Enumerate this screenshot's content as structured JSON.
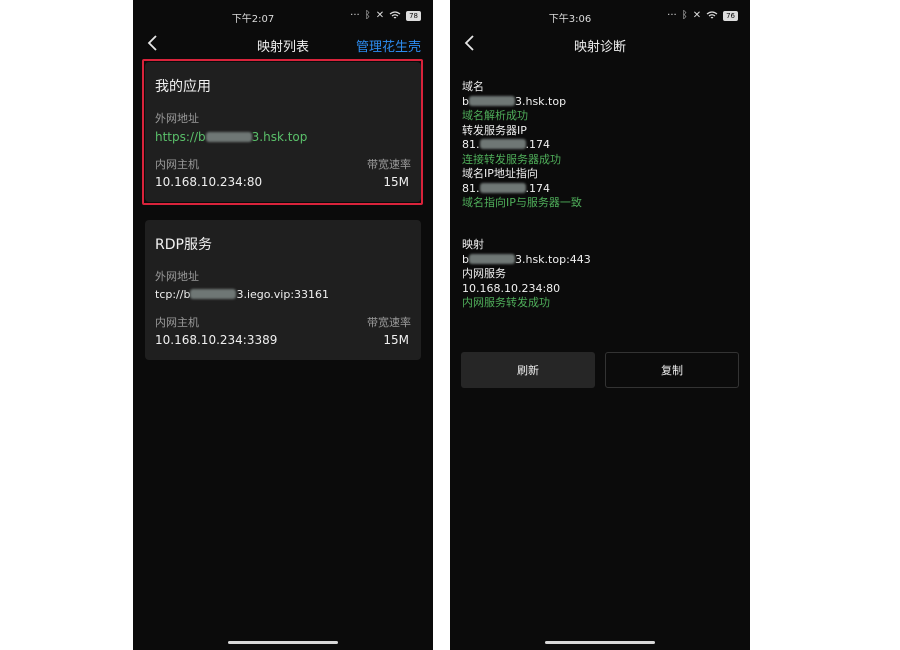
{
  "left": {
    "time": "下午2:07",
    "battery": "78",
    "title": "映射列表",
    "action": "管理花生壳",
    "cards": [
      {
        "title": "我的应用",
        "ext_label": "外网地址",
        "ext_prefix": "https://b",
        "ext_suffix": "3.hsk.top",
        "host_label": "内网主机",
        "host_value": "10.168.10.234:80",
        "bw_label": "带宽速率",
        "bw_value": "15M"
      },
      {
        "title": "RDP服务",
        "ext_label": "外网地址",
        "ext_prefix": "tcp://b",
        "ext_suffix": "3.iego.vip:33161",
        "host_label": "内网主机",
        "host_value": "10.168.10.234:3389",
        "bw_label": "带宽速率",
        "bw_value": "15M"
      }
    ]
  },
  "right": {
    "time": "下午3:06",
    "battery": "76",
    "title": "映射诊断",
    "domain_label": "域名",
    "domain_prefix": "b",
    "domain_suffix": "3.hsk.top",
    "domain_ok": "域名解析成功",
    "forward_label": "转发服务器IP",
    "forward_prefix": "81.",
    "forward_suffix": ".174",
    "forward_ok": "连接转发服务器成功",
    "dns_label": "域名IP地址指向",
    "dns_prefix": "81.",
    "dns_suffix": ".174",
    "dns_ok": "域名指向IP与服务器一致",
    "map_label": "映射",
    "map_prefix": "b",
    "map_suffix": "3.hsk.top:443",
    "inner_label": "内网服务",
    "inner_value": "10.168.10.234:80",
    "inner_ok": "内网服务转发成功",
    "refresh": "刷新",
    "copy": "复制"
  },
  "colors": {
    "accent": "#2d8cf0",
    "success": "#4fae5a",
    "highlight": "#d9233b"
  }
}
